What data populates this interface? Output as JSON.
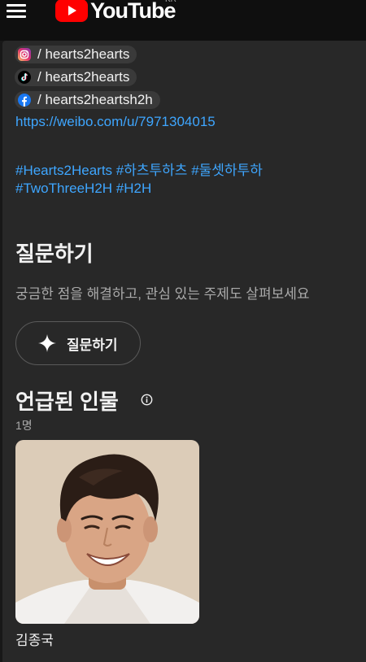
{
  "header": {
    "logo_text": "YouTube",
    "region": "KR",
    "brand_color": "#ff0000"
  },
  "links": {
    "instagram": {
      "icon": "instagram-icon",
      "text": "/ hearts2hearts"
    },
    "tiktok": {
      "icon": "tiktok-icon",
      "text": "/ hearts2hearts"
    },
    "facebook": {
      "icon": "facebook-icon",
      "text": "/ hearts2heartsh2h"
    },
    "weibo_url": "https://weibo.com/u/7971304015"
  },
  "hashtags": {
    "line1": [
      "#Hearts2Hearts",
      "#하츠투하츠",
      "#둘셋하투하"
    ],
    "line2": [
      "#TwoThreeH2H",
      "#H2H"
    ]
  },
  "ask": {
    "title": "질문하기",
    "subtitle": "궁금한 점을 해결하고, 관심 있는 주제도 살펴보세요",
    "button_label": "질문하기"
  },
  "mentioned": {
    "title": "언급된 인물",
    "count": "1명",
    "people": [
      {
        "name": "김종국"
      }
    ]
  }
}
